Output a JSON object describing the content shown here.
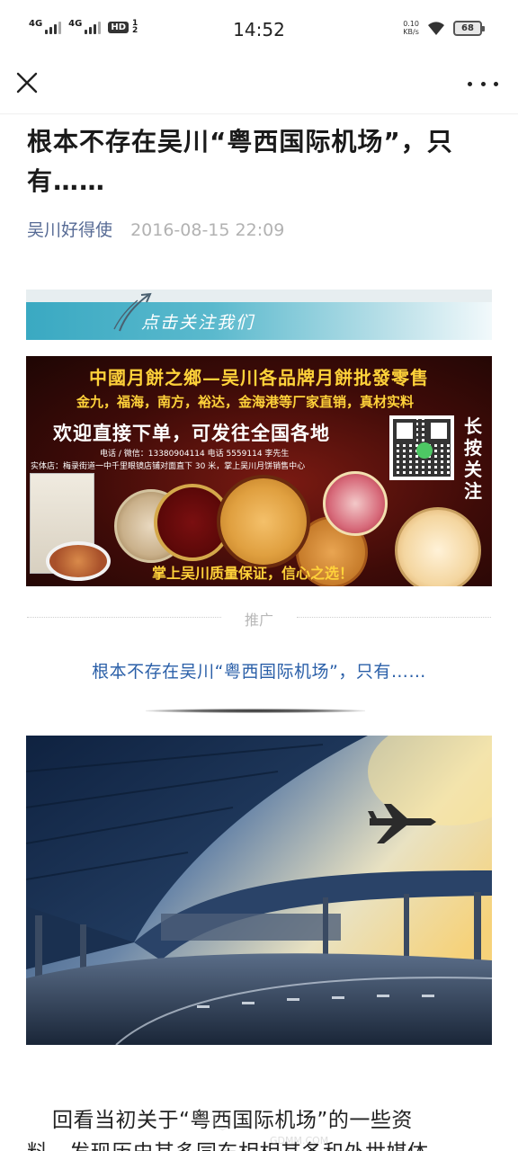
{
  "status_bar": {
    "network_1": "4G",
    "network_2": "4G",
    "hd_label": "HD",
    "hd_sim": "1",
    "hd_slot": "2",
    "time": "14:52",
    "speed_value": "0.10",
    "speed_unit": "KB/s",
    "battery": "68"
  },
  "nav": {
    "close_icon": "close-icon",
    "more_icon": "more-dots-icon"
  },
  "article": {
    "title": "根本不存在吴川“粤西国际机场”，只有……",
    "author": "吴川好得使",
    "date": "2016-08-15 22:09"
  },
  "follow_banner": {
    "text": "点击关注我们"
  },
  "ad": {
    "headline": "中國月餅之鄉—吴川各品牌月餅批發零售",
    "brands": "金九，福海，南方，裕达，金海港等厂家直销，真材实料",
    "main": "欢迎直接下单，可发往全国各地",
    "contact": "电话 / 微信：13380904114  电话 5559114  李先生",
    "store": "实体店：梅录街道一中千里眼镜店铺对面直下 30 米，掌上吴川月饼销售中心",
    "follow_vertical": "长按关注",
    "guarantee": "掌上吴川质量保证，信心之选！"
  },
  "promotion": {
    "label": "推广",
    "link_text": "根本不存在吴川“粤西国际机场”，只有……"
  },
  "body": {
    "paragraph_line1": "回看当初关于“粤西国际机场”的一些资",
    "paragraph_line2": "料，发现历史其多同东相相其各和外世媒体",
    "watermark": "GDMM.COM"
  },
  "colors": {
    "link_blue": "#576b95",
    "promo_blue": "#2a5fa8",
    "meta_gray": "#b2b2b2",
    "ad_gold": "#ffd23a",
    "ad_red": "#5a0808"
  }
}
